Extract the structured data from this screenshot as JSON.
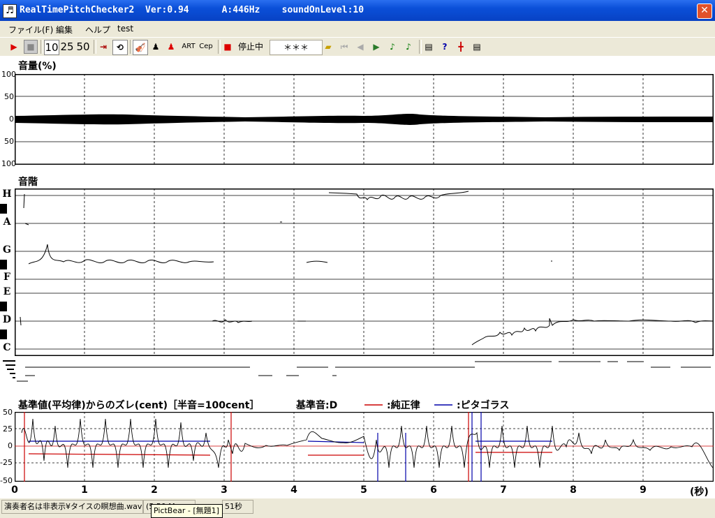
{
  "window": {
    "title": "RealTimePitchChecker2  Ver:0.94      A:446Hz    soundOnLevel:10"
  },
  "menu": [
    "ファイル(F)",
    "編集",
    "ヘルプ",
    "test"
  ],
  "toolbar": {
    "zoom": [
      "10",
      "25",
      "50"
    ],
    "art": "ART",
    "cep": "Cep",
    "status": "停止中",
    "stars": "＊＊＊"
  },
  "volume": {
    "title": "音量(%)",
    "ticks": [
      "100",
      "50",
      "0",
      "50",
      "100"
    ]
  },
  "scale": {
    "title": "音階",
    "notes": [
      "H",
      "A",
      "G",
      "F",
      "E",
      "D",
      "C"
    ]
  },
  "deviation": {
    "title": "基準値(平均律)からのズレ(cent)［半音=100cent］",
    "base": "基準音:D",
    "legend_just": ":純正律",
    "legend_pyth": ":ピタゴラス",
    "ticks": [
      "50",
      "25",
      "0",
      "-25",
      "-50"
    ]
  },
  "time_axis": {
    "ticks": [
      "0",
      "1",
      "2",
      "3",
      "4",
      "5",
      "6",
      "7",
      "8",
      "9"
    ],
    "unit": "(秒)"
  },
  "status": {
    "file": "演奏者名は非表示¥タイスの瞑想曲.wav",
    "mid": "(5.50 M",
    "taskbar": "PictBear - [無題1]",
    "sec": "51秒"
  },
  "colors": {
    "just": "#cc0000",
    "pyth": "#0000aa"
  }
}
